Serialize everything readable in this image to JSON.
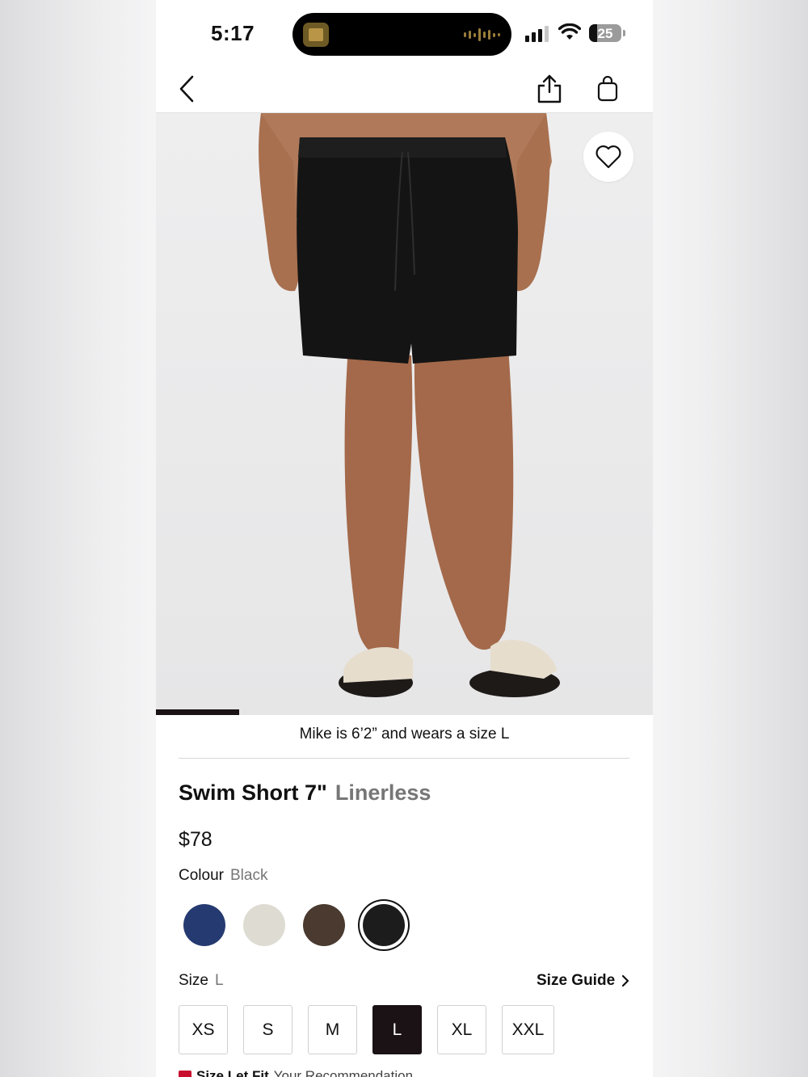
{
  "status_bar": {
    "time": "5:17",
    "battery": "25"
  },
  "nav": {
    "back": "back",
    "share": "share",
    "bag": "bag"
  },
  "product_image": {
    "gallery_progress": 0.167
  },
  "model_note": "Mike is 6’2” and wears a size L",
  "product": {
    "name": "Swim Short 7\"",
    "subtitle": "Linerless",
    "price": "$78"
  },
  "colour": {
    "label": "Colour",
    "selected": "Black",
    "swatches": [
      {
        "color": "#253a70"
      },
      {
        "color": "#dedbd2"
      },
      {
        "color": "#4a3a2f"
      },
      {
        "color": "#1c1c1c",
        "selected": true
      }
    ]
  },
  "size": {
    "label": "Size",
    "selected": "L",
    "guide_label": "Size Guide",
    "options": [
      "XS",
      "S",
      "M",
      "L",
      "XL",
      "XXL"
    ]
  },
  "bottom_cutoff": {
    "bold": "Size Let Fit",
    "text": "Your Recommendation"
  },
  "colors": {
    "accent": "#1a1214",
    "muted": "#767676",
    "badge": "#c8102e"
  }
}
